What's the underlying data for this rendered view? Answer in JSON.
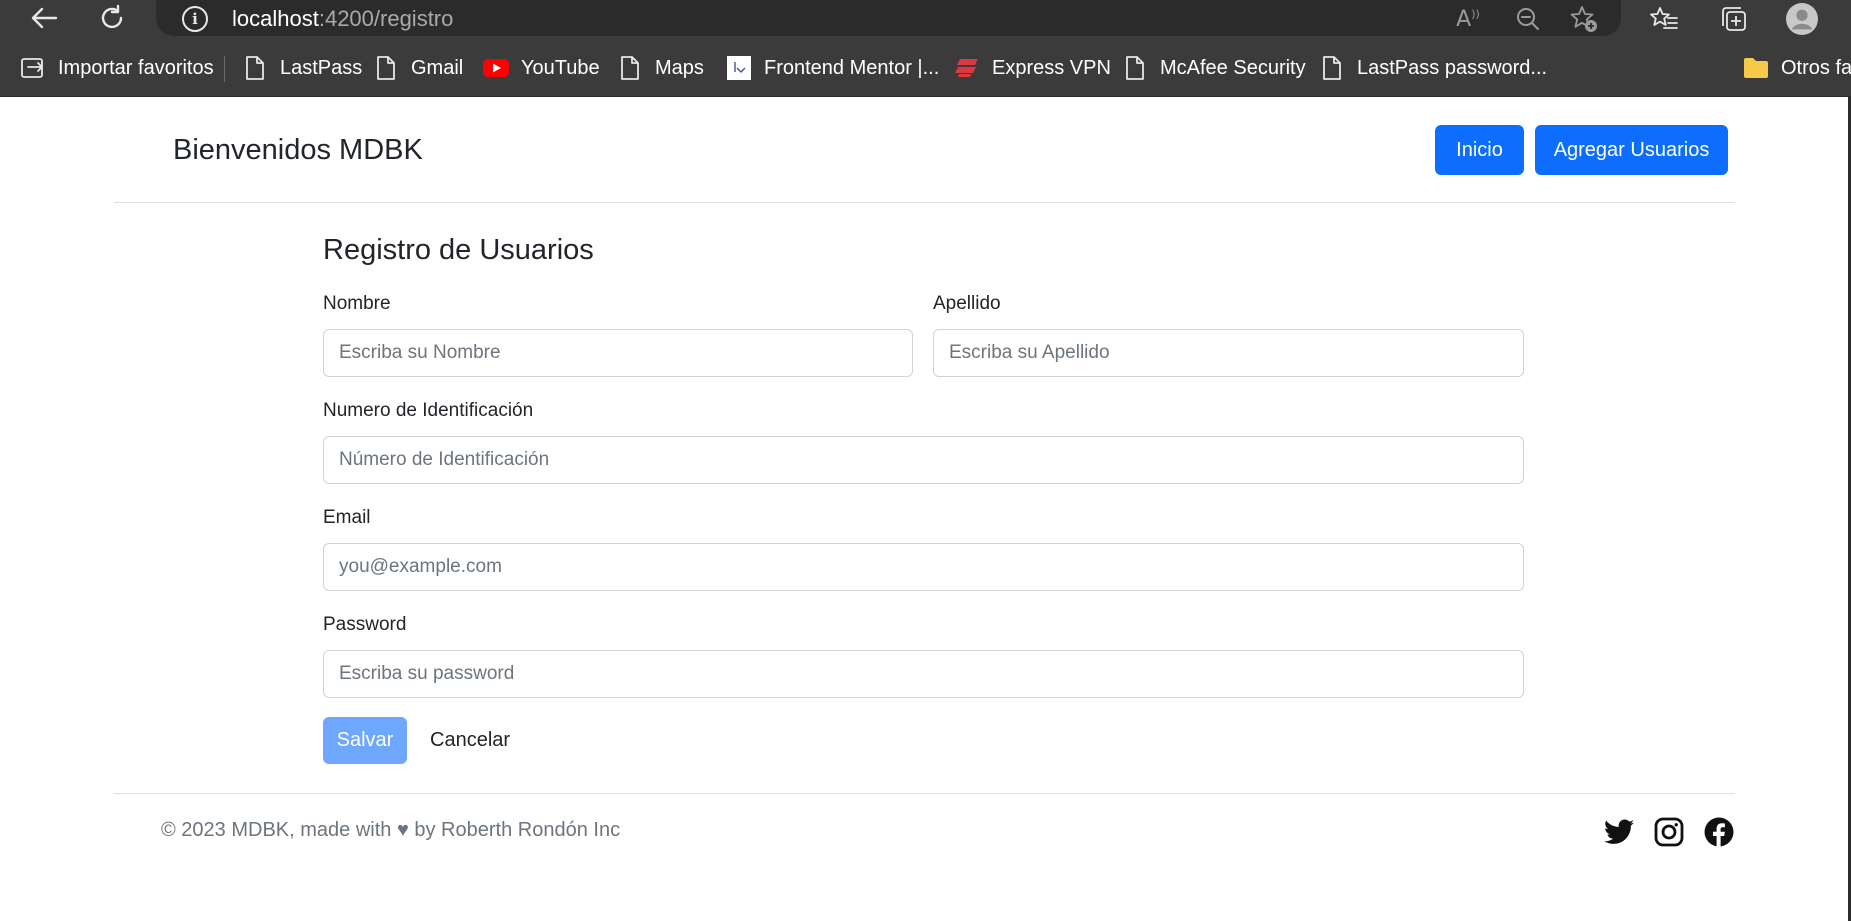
{
  "browser": {
    "url_host": "localhost",
    "url_path": ":4200/registro",
    "back_icon": "arrow-left-icon",
    "reload_icon": "reload-icon",
    "site_info_icon": "info-icon",
    "read_aloud_label": "A",
    "bookmarks": [
      {
        "label": "Importar favoritos",
        "icon": "import-icon"
      },
      {
        "label": "LastPass",
        "icon": "file-icon"
      },
      {
        "label": "Gmail",
        "icon": "file-icon"
      },
      {
        "label": "YouTube",
        "icon": "youtube-icon"
      },
      {
        "label": "Maps",
        "icon": "file-icon"
      },
      {
        "label": "Frontend Mentor |...",
        "icon": "frontend-mentor-icon"
      },
      {
        "label": "Express VPN",
        "icon": "expressvpn-icon"
      },
      {
        "label": "McAfee Security",
        "icon": "file-icon"
      },
      {
        "label": "LastPass password...",
        "icon": "file-icon"
      },
      {
        "label": "Otros fav",
        "icon": "folder-icon"
      }
    ]
  },
  "header": {
    "title": "Bienvenidos MDBK",
    "nav": [
      {
        "label": "Inicio"
      },
      {
        "label": "Agregar Usuarios"
      }
    ]
  },
  "form": {
    "title": "Registro de Usuarios",
    "nombre": {
      "label": "Nombre",
      "placeholder": "Escriba su Nombre",
      "value": ""
    },
    "apellido": {
      "label": "Apellido",
      "placeholder": "Escriba su Apellido",
      "value": ""
    },
    "identificacion": {
      "label": "Numero de Identificación",
      "placeholder": "Número de Identificación",
      "value": ""
    },
    "email": {
      "label": "Email",
      "placeholder": "you@example.com",
      "value": ""
    },
    "password": {
      "label": "Password",
      "placeholder": "Escriba su password",
      "value": ""
    },
    "save_label": "Salvar",
    "cancel_label": "Cancelar"
  },
  "footer": {
    "text": "© 2023 MDBK, made with ♥ by Roberth Rondón Inc",
    "social": [
      "twitter-icon",
      "instagram-icon",
      "facebook-icon"
    ]
  },
  "colors": {
    "primary": "#0d6efd",
    "primary_disabled": "#6ea8fe",
    "chrome_bg": "#3b3b3b"
  }
}
